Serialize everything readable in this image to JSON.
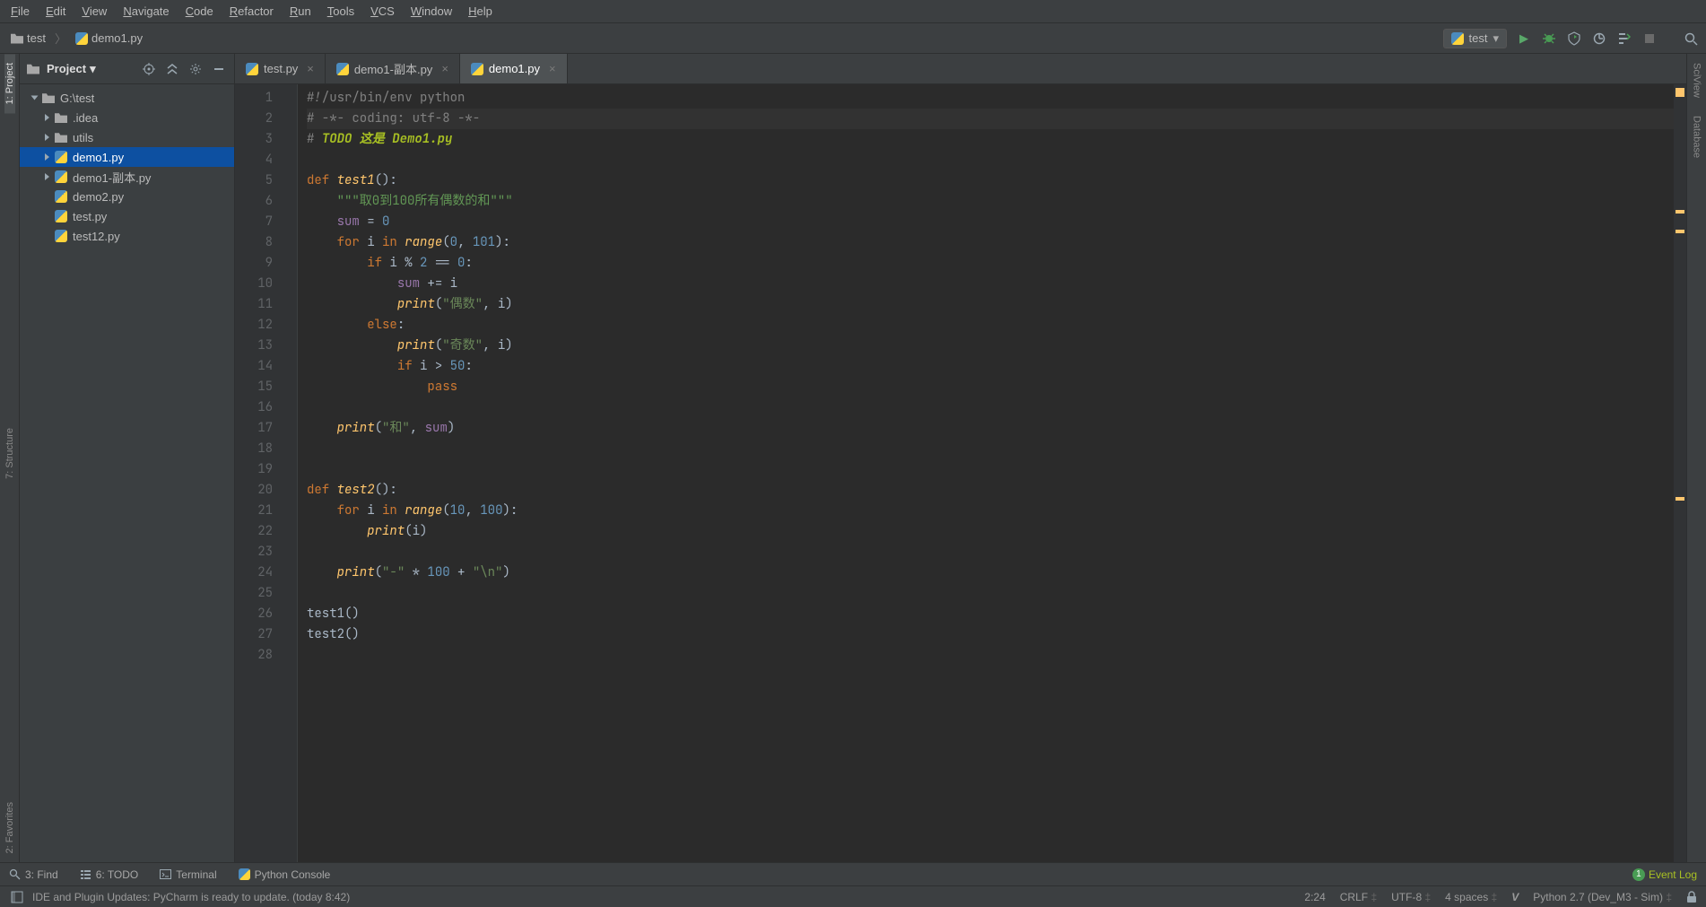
{
  "menubar": [
    "File",
    "Edit",
    "View",
    "Navigate",
    "Code",
    "Refactor",
    "Run",
    "Tools",
    "VCS",
    "Window",
    "Help"
  ],
  "breadcrumbs": {
    "root": "test",
    "file": "demo1.py"
  },
  "run_config": {
    "label": "test"
  },
  "left_tool_tabs": [
    "1: Project",
    "7: Structure",
    "2: Favorites"
  ],
  "right_tool_tabs": [
    "SciView",
    "Database"
  ],
  "project_pane": {
    "title": "Project",
    "root": "G:\\test",
    "tree": [
      {
        "label": "G:\\test",
        "type": "folder",
        "expanded": true,
        "level": 0
      },
      {
        "label": ".idea",
        "type": "folder",
        "expanded": false,
        "level": 1
      },
      {
        "label": "utils",
        "type": "folder",
        "expanded": false,
        "level": 1
      },
      {
        "label": "demo1.py",
        "type": "py",
        "expanded": false,
        "level": 1,
        "arrow": true,
        "selected": true
      },
      {
        "label": "demo1-副本.py",
        "type": "py",
        "expanded": false,
        "level": 1,
        "arrow": true
      },
      {
        "label": "demo2.py",
        "type": "py",
        "level": 1
      },
      {
        "label": "test.py",
        "type": "py",
        "level": 1
      },
      {
        "label": "test12.py",
        "type": "py",
        "level": 1
      }
    ]
  },
  "editor_tabs": [
    {
      "label": "test.py",
      "active": false
    },
    {
      "label": "demo1-副本.py",
      "active": false
    },
    {
      "label": "demo1.py",
      "active": true
    }
  ],
  "code_lines": [
    {
      "n": 1,
      "html": "<span class='cmt'>#!/usr/bin/env python</span>"
    },
    {
      "n": 2,
      "html": "<span class='cmt'># -*- coding: utf-8 -*-</span>",
      "current": true
    },
    {
      "n": 3,
      "html": "<span class='cmt'>#</span> <span class='todo-c'>TODO 这是 Demo1.py</span>"
    },
    {
      "n": 4,
      "html": ""
    },
    {
      "n": 5,
      "html": "<span class='kw'>def </span><span class='fn'>test1</span>():"
    },
    {
      "n": 6,
      "html": "    <span class='doc'>\"\"\"取0到100所有偶数的和\"\"\"</span>"
    },
    {
      "n": 7,
      "html": "    <span class='sf'>sum</span> = <span class='num'>0</span>"
    },
    {
      "n": 8,
      "html": "    <span class='kw'>for </span>i <span class='kw'>in </span><span class='fn'>range</span>(<span class='num'>0</span>, <span class='num'>101</span>):"
    },
    {
      "n": 9,
      "html": "        <span class='kw'>if </span>i % <span class='num'>2</span> == <span class='num'>0</span>:"
    },
    {
      "n": 10,
      "html": "            <span class='sf'>sum</span> += i"
    },
    {
      "n": 11,
      "html": "            <span class='fn'>print</span>(<span class='str'>\"偶数\"</span>, i)"
    },
    {
      "n": 12,
      "html": "        <span class='kw'>else</span>:"
    },
    {
      "n": 13,
      "html": "            <span class='fn'>print</span>(<span class='str'>\"奇数\"</span>, i)"
    },
    {
      "n": 14,
      "html": "            <span class='kw'>if </span>i &gt; <span class='num'>50</span>:"
    },
    {
      "n": 15,
      "html": "                <span class='kw'>pass</span>"
    },
    {
      "n": 16,
      "html": ""
    },
    {
      "n": 17,
      "html": "    <span class='fn'>print</span>(<span class='str'>\"和\"</span>, <span class='sf'>sum</span>)"
    },
    {
      "n": 18,
      "html": ""
    },
    {
      "n": 19,
      "html": ""
    },
    {
      "n": 20,
      "html": "<span class='kw'>def </span><span class='fn'>test2</span>():"
    },
    {
      "n": 21,
      "html": "    <span class='kw'>for </span>i <span class='kw'>in </span><span class='fn'>range</span>(<span class='num'>10</span>, <span class='num'>100</span>):"
    },
    {
      "n": 22,
      "html": "        <span class='fn'>print</span>(i)"
    },
    {
      "n": 23,
      "html": ""
    },
    {
      "n": 24,
      "html": "    <span class='fn'>print</span>(<span class='str'>\"-\"</span> * <span class='num'>100</span> + <span class='str'>\"\\n\"</span>)"
    },
    {
      "n": 25,
      "html": ""
    },
    {
      "n": 26,
      "html": "test1()"
    },
    {
      "n": 27,
      "html": "test2()"
    },
    {
      "n": 28,
      "html": ""
    }
  ],
  "bottom_tools": {
    "find": "3: Find",
    "todo": "6: TODO",
    "terminal": "Terminal",
    "pyconsole": "Python Console",
    "event_log": "Event Log",
    "event_count": "1"
  },
  "status": {
    "message": "IDE and Plugin Updates: PyCharm is ready to update. (today 8:42)",
    "pos": "2:24",
    "line_sep": "CRLF",
    "encoding": "UTF-8",
    "indent": "4 spaces",
    "interpreter": "Python 2.7 (Dev_M3 - Sim)"
  }
}
